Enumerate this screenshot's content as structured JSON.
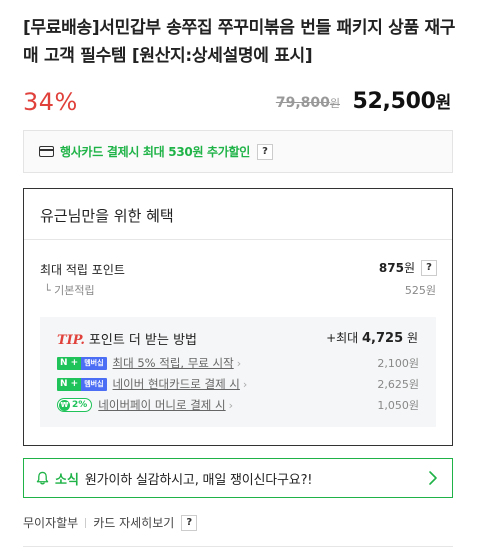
{
  "product": {
    "title": "[무료배송]서민갑부 송쭈집 쭈꾸미볶음 번들 패키지 상품 재구매 고객 필수템 [원산지:상세설명에 표시]"
  },
  "price": {
    "discount": "34%",
    "original": "79,800",
    "original_unit": "원",
    "sale": "52,500",
    "sale_unit": "원"
  },
  "card_promo": {
    "text": "행사카드 결제시 최대 530원 추가할인",
    "help": "?"
  },
  "benefits": {
    "title": "유근님만을 위한 혜택",
    "max_label": "최대 적립 포인트",
    "max_value": "875",
    "max_unit": "원",
    "help": "?",
    "basic_label": "└ 기본적립",
    "basic_value": "525원",
    "tip": {
      "tag": "TIP.",
      "label": "포인트 더 받는 방법",
      "total_prefix": "+최대 ",
      "total_value": "4,725",
      "total_unit": " 원",
      "rows": [
        {
          "badge_n": "N +",
          "badge_text": "멤버십",
          "text": "최대 5% 적립, 무료 시작",
          "value": "2,100원"
        },
        {
          "badge_n": "N +",
          "badge_text": "멤버십",
          "text": "네이버 현대카드로 결제 시",
          "value": "2,625원"
        },
        {
          "badge_n": "₩",
          "badge_text": "2%",
          "text": "네이버페이 머니로 결제 시",
          "value": "1,050원"
        }
      ]
    }
  },
  "notice": {
    "tag": "소식",
    "text": "원가이하 실감하시고, 매일 쟁이신다구요?!"
  },
  "bottom": {
    "installment": "무이자할부",
    "card_detail": "카드 자세히보기",
    "help": "?"
  },
  "icons": {
    "card": "credit-card-icon",
    "bell": "bell-icon",
    "chevron": "chevron-right-icon"
  },
  "colors": {
    "discount": "#e0413b",
    "accent_green": "#1fb347",
    "membership_blue": "#4c6ef5"
  }
}
